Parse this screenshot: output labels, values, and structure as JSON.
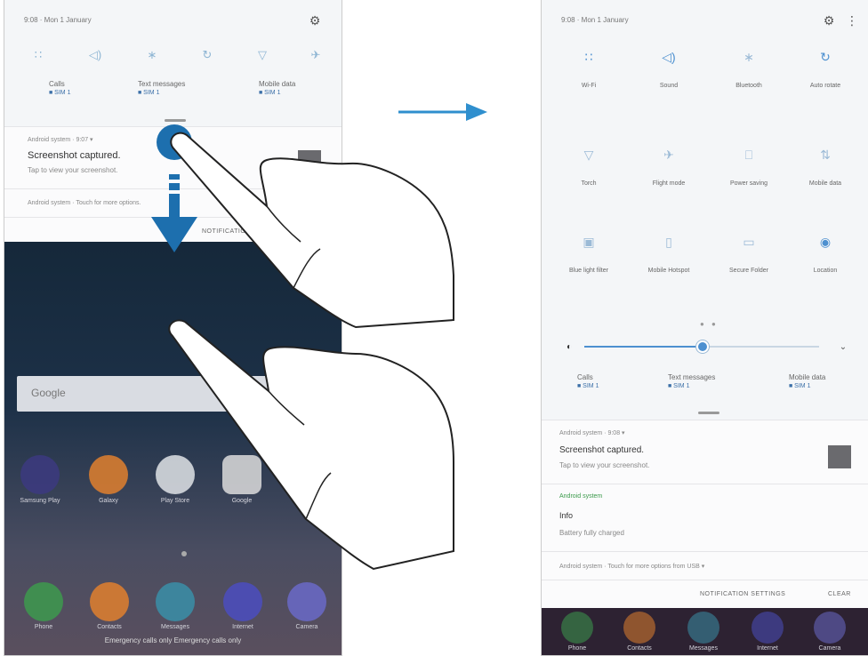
{
  "left": {
    "status": "9:08 · Mon 1 January",
    "data_items": [
      {
        "label": "Calls",
        "sub": "■ SIM 1"
      },
      {
        "label": "Text messages",
        "sub": "■ SIM 1"
      },
      {
        "label": "Mobile data",
        "sub": "■ SIM 1"
      }
    ],
    "notification": {
      "meta": "Android system · 9:07 ▾",
      "title": "Screenshot captured.",
      "text": "Tap to view your screenshot."
    },
    "footer_notif": "Android system · Touch for more options.",
    "footer_btn": "NOTIFICATION SETTINGS",
    "search_placeholder": "Google",
    "app_labels": [
      "Samsung Play",
      "Galaxy",
      "Play Store",
      "Google",
      ""
    ],
    "dock_labels": [
      "Phone",
      "Contacts",
      "Messages",
      "Internet",
      "Camera"
    ],
    "emergency": "Emergency calls only  Emergency calls only"
  },
  "right": {
    "status": "9:08 · Mon 1 January",
    "tiles": [
      {
        "label": "Wi-Fi",
        "icon": "wifi-icon",
        "glyph": "∷"
      },
      {
        "label": "Sound",
        "icon": "sound-icon",
        "glyph": "◁)"
      },
      {
        "label": "Bluetooth",
        "icon": "bluetooth-icon",
        "glyph": "∗"
      },
      {
        "label": "Auto rotate",
        "icon": "auto-rotate-icon",
        "glyph": "↻"
      },
      {
        "label": "Torch",
        "icon": "torch-icon",
        "glyph": "▽"
      },
      {
        "label": "Flight mode",
        "icon": "flight-mode-icon",
        "glyph": "✈"
      },
      {
        "label": "Power saving",
        "icon": "power-saving-icon",
        "glyph": "⎕"
      },
      {
        "label": "Mobile data",
        "icon": "mobile-data-icon",
        "glyph": "⇅"
      },
      {
        "label": "Blue light filter",
        "icon": "blue-light-filter-icon",
        "glyph": "▣"
      },
      {
        "label": "Mobile Hotspot",
        "icon": "mobile-hotspot-icon",
        "glyph": "▯"
      },
      {
        "label": "Secure Folder",
        "icon": "secure-folder-icon",
        "glyph": "▭"
      },
      {
        "label": "Location",
        "icon": "location-icon",
        "glyph": "◉"
      }
    ],
    "page_dots": "● ●",
    "data_items": [
      {
        "label": "Calls",
        "sub": "■ SIM 1"
      },
      {
        "label": "Text messages",
        "sub": "■ SIM 1"
      },
      {
        "label": "Mobile data",
        "sub": "■ SIM 1"
      }
    ],
    "notification1": {
      "meta": "Android system · 9:08 ▾",
      "title": "Screenshot captured.",
      "text": "Tap to view your screenshot."
    },
    "notification2": {
      "meta": "Android system",
      "title": "Info",
      "text": "Battery fully charged"
    },
    "footer_notif": "Android system · Touch for more options from USB ▾",
    "buttons": {
      "settings": "NOTIFICATION SETTINGS",
      "clear": "CLEAR"
    },
    "dock_labels": [
      "Phone",
      "Contacts",
      "Messages",
      "Internet",
      "Camera"
    ]
  },
  "colors": {
    "accent": "#4d90d0",
    "arrow": "#2f8fce",
    "touch": "#1d6fae"
  }
}
